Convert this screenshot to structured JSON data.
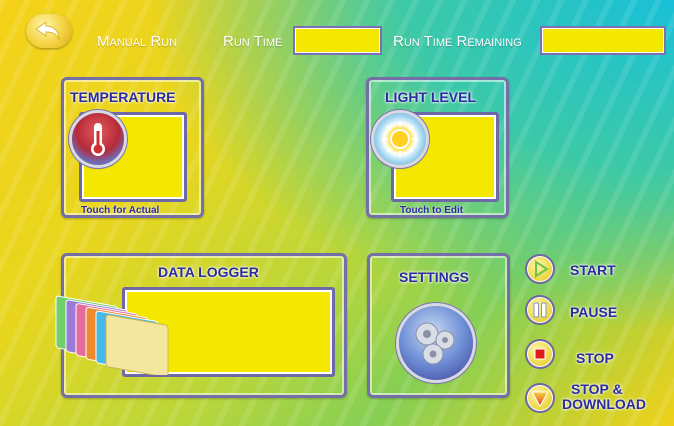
{
  "header": {
    "mode_label": "Manual Run",
    "run_time_label": "Run Time",
    "run_time_value": "",
    "remaining_label": "Run Time Remaining",
    "remaining_value": ""
  },
  "temperature": {
    "title": "TEMPERATURE",
    "value": "",
    "hint": "Touch for Actual"
  },
  "light_level": {
    "title": "LIGHT LEVEL",
    "value": "",
    "hint": "Touch to Edit"
  },
  "data_logger": {
    "title": "DATA LOGGER",
    "value": ""
  },
  "settings": {
    "title": "SETTINGS"
  },
  "controls": {
    "start": "START",
    "pause": "PAUSE",
    "stop": "STOP",
    "stop_download_line1": "STOP &",
    "stop_download_line2": "DOWNLOAD"
  },
  "colors": {
    "display_yellow": "#f5e800",
    "frame_purple": "#756fa8",
    "label_blue": "#2c2aa0"
  }
}
